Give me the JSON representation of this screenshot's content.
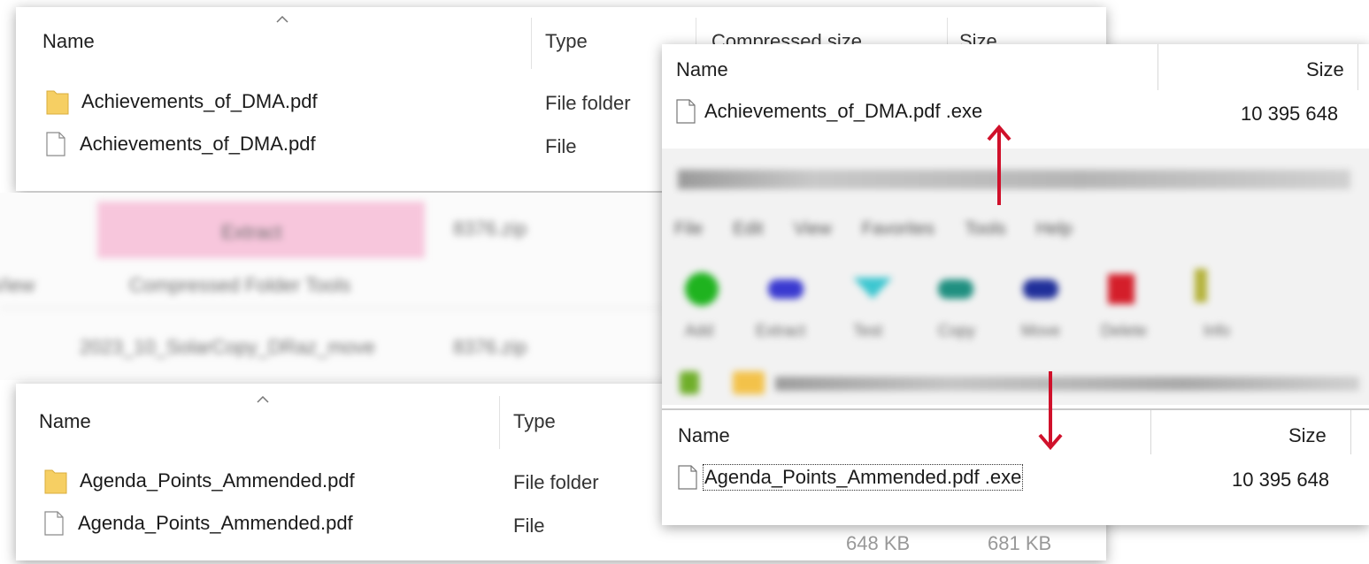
{
  "top_explorer": {
    "columns": {
      "name": "Name",
      "type": "Type",
      "compressed_size": "Compressed size",
      "size": "Size"
    },
    "rows": [
      {
        "name": "Achievements_of_DMA.pdf",
        "type": "File folder",
        "icon": "folder-icon"
      },
      {
        "name": "Achievements_of_DMA.pdf",
        "type": "File",
        "icon": "file-icon"
      }
    ]
  },
  "blurred_explorer": {
    "extract_tab": "Extract",
    "zip_name": "8376.zip",
    "view_tab": "View",
    "compressed_tools_tab": "Compressed Folder Tools",
    "breadcrumb": "2023_10_SolarCopy_DRaz_move",
    "breadcrumb_end": "8376.zip"
  },
  "bottom_explorer": {
    "columns": {
      "name": "Name",
      "type": "Type"
    },
    "rows": [
      {
        "name": "Agenda_Points_Ammended.pdf",
        "type": "File folder",
        "icon": "folder-icon",
        "compressed": "",
        "size": ""
      },
      {
        "name": "Agenda_Points_Ammended.pdf",
        "type": "File",
        "icon": "file-icon",
        "compressed": "648 KB",
        "size": "681 KB"
      }
    ]
  },
  "archiver": {
    "top_list": {
      "columns": {
        "name": "Name",
        "size": "Size"
      },
      "rows": [
        {
          "name": "Achievements_of_DMA.pdf .exe",
          "size": "10 395 648"
        }
      ]
    },
    "menu": [
      "File",
      "Edit",
      "View",
      "Favorites",
      "Tools",
      "Help"
    ],
    "toolbar": [
      "Add",
      "Extract",
      "Test",
      "Copy",
      "Move",
      "Delete",
      "Info"
    ],
    "bottom_list": {
      "columns": {
        "name": "Name",
        "size": "Size"
      },
      "rows": [
        {
          "name": "Agenda_Points_Ammended.pdf .exe",
          "size": "10 395 648"
        }
      ]
    }
  },
  "colors": {
    "arrow_red": "#d0112b",
    "extract_pink": "#f7c6dc",
    "folder_yellow": "#f6cf63"
  }
}
